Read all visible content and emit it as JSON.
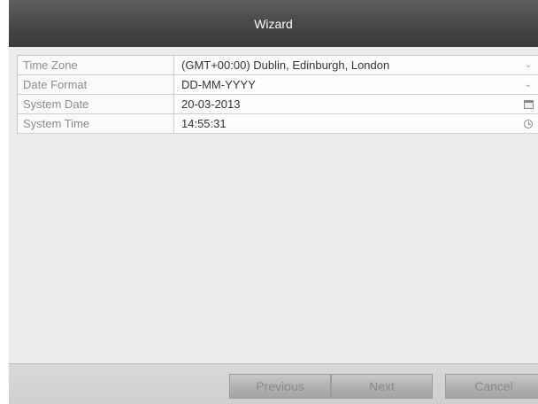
{
  "window": {
    "title": "Wizard"
  },
  "settings": {
    "rows": [
      {
        "label": "Time Zone",
        "value": "(GMT+00:00) Dublin, Edinburgh, London",
        "icon": "chevron-down-icon"
      },
      {
        "label": "Date Format",
        "value": "DD-MM-YYYY",
        "icon": "chevron-down-icon"
      },
      {
        "label": "System Date",
        "value": "20-03-2013",
        "icon": "calendar-icon"
      },
      {
        "label": "System Time",
        "value": "14:55:31",
        "icon": "clock-icon"
      }
    ]
  },
  "buttons": {
    "previous": "Previous",
    "next": "Next",
    "cancel": "Cancel"
  },
  "colors": {
    "titlebar": "#4a4a4a",
    "background": "#ececec",
    "label_text": "#8c8c8c",
    "button_text": "#8a8a8a"
  }
}
